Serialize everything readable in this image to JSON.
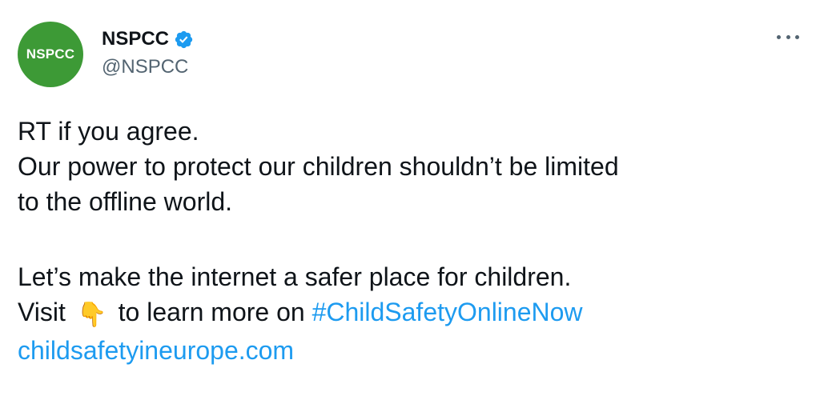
{
  "author": {
    "avatar_text": "NSPCC",
    "avatar_color": "#3d9a36",
    "display_name": "NSPCC",
    "handle": "@NSPCC",
    "verified": true,
    "verified_color": "#1d9bf0"
  },
  "menu": {
    "icon": "more-horizontal-icon"
  },
  "tweet": {
    "line1": "RT if you agree.",
    "line2": "Our power to protect our children shouldn’t be limited",
    "line3": "to the offline world.",
    "line4": "Let’s make the internet a safer place for children.",
    "line5_prefix": "Visit",
    "line5_emoji": "👇",
    "line5_middle": "to learn more on",
    "hashtag": "#ChildSafetyOnlineNow",
    "url": "childsafetyineurope.com"
  },
  "colors": {
    "link": "#1d9bf0",
    "text": "#0f1419",
    "secondary": "#536471"
  }
}
